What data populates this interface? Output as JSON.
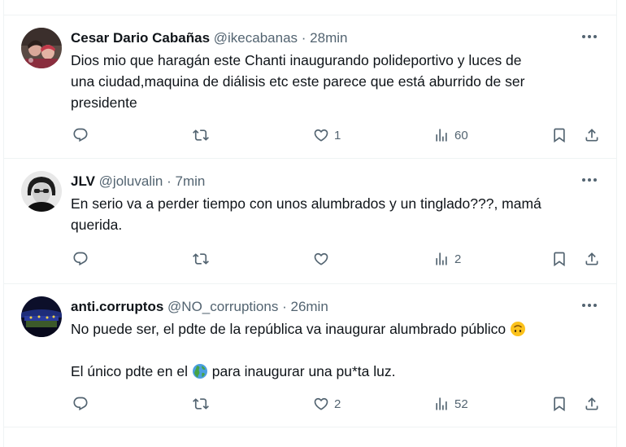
{
  "tweets": [
    {
      "name": "Cesar Dario Cabañas",
      "handle": "@ikecabanas",
      "separator": "·",
      "time": "28min",
      "lines": [
        "Dios mio que haragán  este Chanti  inaugurando  polideportivo y luces de",
        "una ciudad,maquina de diálisis etc este parece que está aburrido  de ser",
        "presidente"
      ],
      "likes": "1",
      "views": "60"
    },
    {
      "name": "JLV",
      "handle": "@joluvalin",
      "separator": "·",
      "time": "7min",
      "lines": [
        "En serio va a perder tiempo con unos alumbrados y un tinglado???, mamá",
        "querida."
      ],
      "likes": "",
      "views": "2"
    },
    {
      "name": "anti.corruptos",
      "handle": "@NO_corruptions",
      "separator": "·",
      "time": "26min",
      "line1": "No puede ser, el pdte de la república va inaugurar alumbrado público",
      "line2_before": "El único pdte en el",
      "line2_after": "para inaugurar una pu*ta luz.",
      "likes": "2",
      "views": "52"
    }
  ],
  "icons": {
    "reply": "reply-icon",
    "retweet": "retweet-icon",
    "like": "heart-icon",
    "views": "views-icon",
    "bookmark": "bookmark-icon",
    "share": "share-icon",
    "more": "more-icon",
    "emoji_upside_down": "upside-down-face-emoji",
    "emoji_globe": "globe-americas-emoji"
  },
  "colors": {
    "text": "#0f1419",
    "secondary": "#536471",
    "border": "#eff3f4"
  }
}
